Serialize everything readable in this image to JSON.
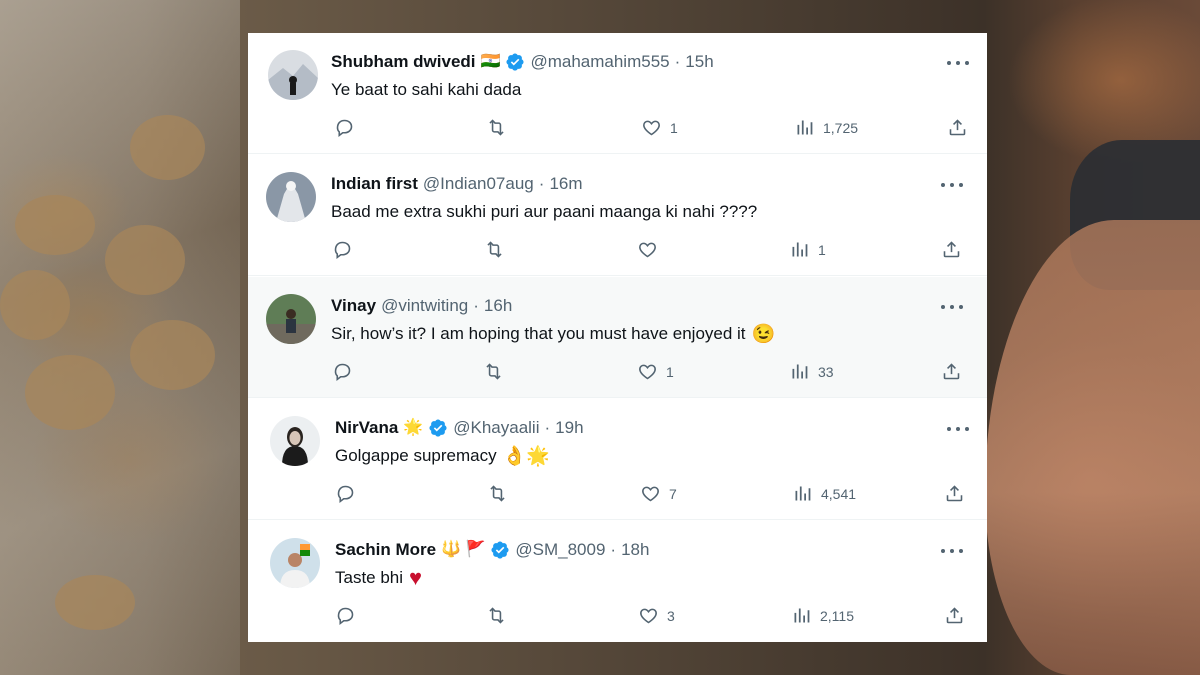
{
  "tweets": [
    {
      "name": "Shubham dwivedi",
      "name_emoji": "🇮🇳",
      "verified": true,
      "handle": "@mahamahim555",
      "sep": "·",
      "time": "15h",
      "text": "Ye baat to sahi kahi dada",
      "likes": "1",
      "views": "1,725",
      "replies": "",
      "retweets": ""
    },
    {
      "name": "Indian first",
      "verified": false,
      "handle": "@Indian07aug",
      "sep": "·",
      "time": "16m",
      "text": "Baad me extra sukhi puri aur paani maanga ki nahi ????",
      "likes": "",
      "views": "1",
      "replies": "",
      "retweets": ""
    },
    {
      "name": "Vinay",
      "verified": false,
      "handle": "@vintwiting",
      "sep": "·",
      "time": "16h",
      "text": "Sir, how’s it? I am hoping that you must have enjoyed it",
      "text_emoji": "😉",
      "likes": "1",
      "views": "33",
      "replies": "",
      "retweets": ""
    },
    {
      "name": "NirVana",
      "name_emoji": "🌟",
      "verified": true,
      "handle": "@Khayaalii",
      "sep": "·",
      "time": "19h",
      "text": "Golgappe supremacy",
      "text_emoji": "👌🌟",
      "likes": "7",
      "views": "4,541",
      "replies": "",
      "retweets": ""
    },
    {
      "name": "Sachin More",
      "name_emoji": "🔱 🚩",
      "verified": true,
      "handle": "@SM_8009",
      "sep": "·",
      "time": "18h",
      "text": "Taste bhi",
      "text_emoji": "♥",
      "likes": "3",
      "views": "2,115",
      "replies": "",
      "retweets": ""
    }
  ],
  "icons": {
    "reply": "reply-icon",
    "retweet": "retweet-icon",
    "like": "like-icon",
    "views": "views-icon",
    "share": "share-icon",
    "more": "more-icon",
    "verified": "verified-badge-icon"
  },
  "colors": {
    "verified": "#1d9bf0",
    "text": "#0f1419",
    "muted": "#536471",
    "heart_emoji": "#c8102e"
  }
}
